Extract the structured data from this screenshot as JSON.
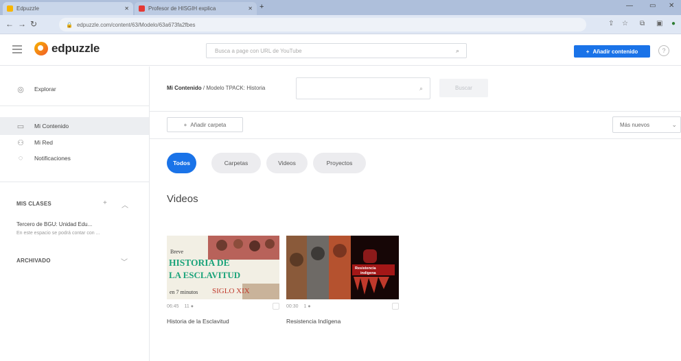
{
  "browser": {
    "tabs": [
      {
        "title": "Edpuzzle",
        "favicon_color": "#f7b500"
      },
      {
        "title": "Profesor de HISGIH explica",
        "favicon_color": "#e53935"
      }
    ],
    "url": "edpuzzle.com/content/63/Modelo/63a673fa2fbes"
  },
  "header": {
    "logo_text": "edpuzzle",
    "search_placeholder": "Busca a page con URL de YouTube",
    "add_content_label": "Añadir contenido",
    "help_label": "?"
  },
  "sidebar": {
    "items": [
      {
        "label": "Explorar",
        "icon": "compass-icon"
      },
      {
        "label": "Mi Contenido",
        "icon": "folder-icon",
        "active": true
      },
      {
        "label": "Mi Red",
        "icon": "network-icon"
      },
      {
        "label": "Notificaciones",
        "icon": "bell-icon"
      }
    ],
    "classes_header": "MIS CLASES",
    "class_name": "Tercero de BGU: Unidad Edu...",
    "class_desc": "En este espacio se podrá contar con ...",
    "archived_header": "ARCHIVADO"
  },
  "main": {
    "breadcrumb_root": "Mi Contenido",
    "breadcrumb_sep": "/",
    "breadcrumb_path": "Modelo TPACK: Historia",
    "search_button": "Buscar",
    "add_folder": "Añadir carpeta",
    "sort_label": "Más nuevos",
    "filters": [
      "Todos",
      "Carpetas",
      "Videos",
      "Proyectos"
    ],
    "section_title": "Videos",
    "videos": [
      {
        "title": "Historia de la Esclavitud",
        "duration": "06:45",
        "views": "11",
        "thumb_lines": [
          "Breve",
          "HISTORIA DE",
          "LA ESCLAVITUD",
          "en 7 minutos",
          "SIGLO XIX"
        ]
      },
      {
        "title": "Resistencia Indígena",
        "duration": "00:30",
        "views": "1",
        "thumb_lines": [
          "Resistencia",
          "indígena"
        ]
      }
    ]
  }
}
